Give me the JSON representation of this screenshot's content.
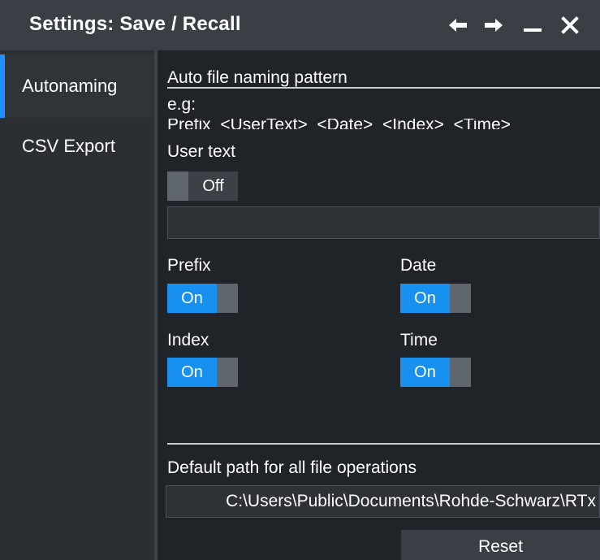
{
  "window": {
    "title": "Settings: Save / Recall",
    "controls": [
      "back-arrow-icon",
      "forward-arrow-icon",
      "minimize-icon",
      "close-icon"
    ]
  },
  "sidebar": {
    "items": [
      {
        "label": "Autonaming",
        "active": true
      },
      {
        "label": "CSV Export",
        "active": false
      }
    ]
  },
  "autonaming": {
    "section_title": "Auto file naming pattern",
    "example_label": "e.g:",
    "example_pattern": "Prefix_<UserText>_<Date>_<Index>_<Time>",
    "user_text": {
      "label": "User text",
      "state": "Off",
      "value": ""
    },
    "prefix": {
      "label": "Prefix",
      "state": "On"
    },
    "date": {
      "label": "Date",
      "state": "On"
    },
    "index": {
      "label": "Index",
      "state": "On"
    },
    "time": {
      "label": "Time",
      "state": "On"
    },
    "default_path_label": "Default path for all file operations",
    "default_path": "C:\\Users\\Public\\Documents\\Rohde-Schwarz\\RTx",
    "reset_label": "Reset"
  },
  "colors": {
    "titlebar": "#3a3f45",
    "sidebar": "#2b2f34",
    "content": "#202327",
    "accent": "#1890f0",
    "active_indicator": "#1e90ff"
  }
}
